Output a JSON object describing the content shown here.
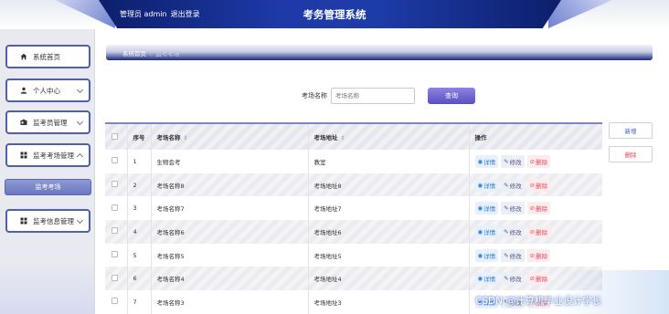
{
  "header": {
    "admin_text": "管理员 admin",
    "logout_label": "退出登录",
    "title": "考务管理系统"
  },
  "sidebar": {
    "items": [
      {
        "label": "系统首页",
        "icon": "home-icon"
      },
      {
        "label": "个人中心",
        "icon": "user-icon"
      },
      {
        "label": "监考员管理",
        "icon": "id-card-icon"
      },
      {
        "label": "监考考场管理",
        "icon": "grid-icon"
      },
      {
        "label": "监考信息管理",
        "icon": "grid-icon"
      }
    ],
    "sub_item": "监考考场"
  },
  "breadcrumb": {
    "home": "系统首页",
    "separator": "/",
    "current": "监考考场"
  },
  "search": {
    "label": "考场名称",
    "placeholder": "考场名称",
    "button": "查询"
  },
  "actions": {
    "add": "新增",
    "delete": "删除"
  },
  "table": {
    "columns": [
      "序号",
      "考场名称",
      "考场地址",
      "操作"
    ],
    "op_labels": {
      "view": "详情",
      "edit": "修改",
      "delete": "删除"
    },
    "rows": [
      {
        "no": "1",
        "name": "生物会考",
        "address": "教室"
      },
      {
        "no": "2",
        "name": "考场名称8",
        "address": "考场地址8"
      },
      {
        "no": "3",
        "name": "考场名称7",
        "address": "考场地址7"
      },
      {
        "no": "4",
        "name": "考场名称6",
        "address": "考场地址6"
      },
      {
        "no": "5",
        "name": "考场名称5",
        "address": "考场地址5"
      },
      {
        "no": "6",
        "name": "考场名称4",
        "address": "考场地址4"
      },
      {
        "no": "7",
        "name": "考场名称3",
        "address": "考场地址3"
      }
    ]
  },
  "watermark": "CSDN @计算机毕业设计学长",
  "colors": {
    "brand": "#1d3aa8",
    "accent": "#5a4fc4",
    "danger": "#e04c5e",
    "info": "#2f7dd6"
  }
}
